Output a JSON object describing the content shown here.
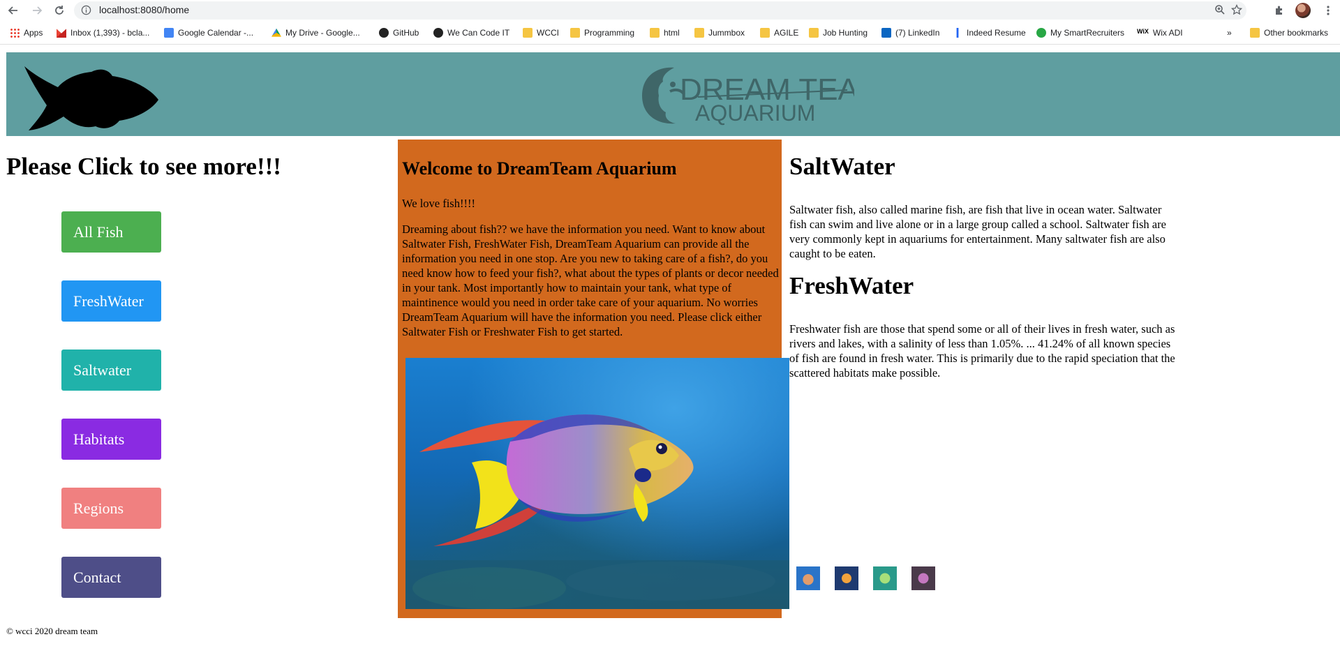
{
  "browser": {
    "url": "localhost:8080/home",
    "bookmarks": [
      {
        "label": "Apps",
        "icon": "apps-grid-icon"
      },
      {
        "label": "Inbox (1,393) - bcla...",
        "icon": "gmail-icon"
      },
      {
        "label": "Google Calendar -...",
        "icon": "google-calendar-icon"
      },
      {
        "label": "My Drive - Google...",
        "icon": "google-drive-icon"
      },
      {
        "label": "GitHub",
        "icon": "github-icon"
      },
      {
        "label": "We Can Code IT",
        "icon": "github-icon"
      },
      {
        "label": "WCCI",
        "icon": "folder-icon"
      },
      {
        "label": "Programming",
        "icon": "folder-icon"
      },
      {
        "label": "html",
        "icon": "folder-icon"
      },
      {
        "label": "Jummbox",
        "icon": "folder-icon"
      },
      {
        "label": "AGILE",
        "icon": "folder-icon"
      },
      {
        "label": "Job Hunting",
        "icon": "folder-icon"
      },
      {
        "label": "(7) LinkedIn",
        "icon": "linkedin-icon"
      },
      {
        "label": "Indeed Resume",
        "icon": "indeed-icon"
      },
      {
        "label": "My SmartRecruiters",
        "icon": "smartrecruiters-icon"
      },
      {
        "label": "Wix ADI",
        "icon": "wix-icon"
      }
    ],
    "more_bookmarks": "»",
    "other_bookmarks": "Other bookmarks"
  },
  "header": {
    "logo_line1": "DREAM TEAM",
    "logo_line2": "AQUARIUM"
  },
  "sidebar": {
    "title": "Please Click to see more!!!",
    "buttons": [
      {
        "label": "All Fish",
        "color": "#4caf50"
      },
      {
        "label": "FreshWater",
        "color": "#2196f3"
      },
      {
        "label": "Saltwater",
        "color": "#20b2aa"
      },
      {
        "label": "Habitats",
        "color": "#8a2be2"
      },
      {
        "label": "Regions",
        "color": "#f08080"
      },
      {
        "label": "Contact",
        "color": "#4e4e88"
      }
    ]
  },
  "welcome": {
    "title": "Welcome to DreamTeam Aquarium",
    "tagline": "We love fish!!!!",
    "body": "Dreaming about fish?? we have the information you need. Want to know about Saltwater Fish, FreshWater Fish, DreamTeam Aquarium can provide all the information you need in one stop. Are you new to taking care of a fish?, do you need know how to feed your fish?, what about the types of plants or decor needed in your tank. Most importantly how to maintain your tank, what type of maintinence would you need in order take care of your aquarium. No worries DreamTeam Aquarium will have the information you need. Please click either Saltwater Fish or Freshwater Fish to get started.",
    "panel_color": "#d2691e"
  },
  "saltwater": {
    "title": "SaltWater",
    "text": "Saltwater fish, also called marine fish, are fish that live in ocean water. Saltwater fish can swim and live alone or in a large group called a school. Saltwater fish are very commonly kept in aquariums for entertainment. Many saltwater fish are also caught to be eaten."
  },
  "freshwater": {
    "title": "FreshWater",
    "text": "Freshwater fish are those that spend some or all of their lives in fresh water, such as rivers and lakes, with a salinity of less than 1.05%. ... 41.24% of all known species of fish are found in fresh water. This is primarily due to the rapid speciation that the scattered habitats make possible."
  },
  "footer": {
    "text": "© wcci 2020 dream team"
  },
  "colors": {
    "header_bg": "#5f9ea0",
    "logo": "#3f6668"
  }
}
